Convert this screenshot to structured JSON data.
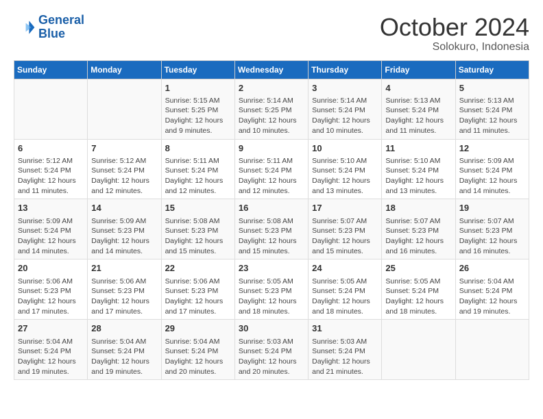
{
  "header": {
    "logo_line1": "General",
    "logo_line2": "Blue",
    "month": "October 2024",
    "location": "Solokuro, Indonesia"
  },
  "weekdays": [
    "Sunday",
    "Monday",
    "Tuesday",
    "Wednesday",
    "Thursday",
    "Friday",
    "Saturday"
  ],
  "weeks": [
    [
      {
        "day": "",
        "info": ""
      },
      {
        "day": "",
        "info": ""
      },
      {
        "day": "1",
        "info": "Sunrise: 5:15 AM\nSunset: 5:25 PM\nDaylight: 12 hours and 9 minutes."
      },
      {
        "day": "2",
        "info": "Sunrise: 5:14 AM\nSunset: 5:25 PM\nDaylight: 12 hours and 10 minutes."
      },
      {
        "day": "3",
        "info": "Sunrise: 5:14 AM\nSunset: 5:24 PM\nDaylight: 12 hours and 10 minutes."
      },
      {
        "day": "4",
        "info": "Sunrise: 5:13 AM\nSunset: 5:24 PM\nDaylight: 12 hours and 11 minutes."
      },
      {
        "day": "5",
        "info": "Sunrise: 5:13 AM\nSunset: 5:24 PM\nDaylight: 12 hours and 11 minutes."
      }
    ],
    [
      {
        "day": "6",
        "info": "Sunrise: 5:12 AM\nSunset: 5:24 PM\nDaylight: 12 hours and 11 minutes."
      },
      {
        "day": "7",
        "info": "Sunrise: 5:12 AM\nSunset: 5:24 PM\nDaylight: 12 hours and 12 minutes."
      },
      {
        "day": "8",
        "info": "Sunrise: 5:11 AM\nSunset: 5:24 PM\nDaylight: 12 hours and 12 minutes."
      },
      {
        "day": "9",
        "info": "Sunrise: 5:11 AM\nSunset: 5:24 PM\nDaylight: 12 hours and 12 minutes."
      },
      {
        "day": "10",
        "info": "Sunrise: 5:10 AM\nSunset: 5:24 PM\nDaylight: 12 hours and 13 minutes."
      },
      {
        "day": "11",
        "info": "Sunrise: 5:10 AM\nSunset: 5:24 PM\nDaylight: 12 hours and 13 minutes."
      },
      {
        "day": "12",
        "info": "Sunrise: 5:09 AM\nSunset: 5:24 PM\nDaylight: 12 hours and 14 minutes."
      }
    ],
    [
      {
        "day": "13",
        "info": "Sunrise: 5:09 AM\nSunset: 5:24 PM\nDaylight: 12 hours and 14 minutes."
      },
      {
        "day": "14",
        "info": "Sunrise: 5:09 AM\nSunset: 5:23 PM\nDaylight: 12 hours and 14 minutes."
      },
      {
        "day": "15",
        "info": "Sunrise: 5:08 AM\nSunset: 5:23 PM\nDaylight: 12 hours and 15 minutes."
      },
      {
        "day": "16",
        "info": "Sunrise: 5:08 AM\nSunset: 5:23 PM\nDaylight: 12 hours and 15 minutes."
      },
      {
        "day": "17",
        "info": "Sunrise: 5:07 AM\nSunset: 5:23 PM\nDaylight: 12 hours and 15 minutes."
      },
      {
        "day": "18",
        "info": "Sunrise: 5:07 AM\nSunset: 5:23 PM\nDaylight: 12 hours and 16 minutes."
      },
      {
        "day": "19",
        "info": "Sunrise: 5:07 AM\nSunset: 5:23 PM\nDaylight: 12 hours and 16 minutes."
      }
    ],
    [
      {
        "day": "20",
        "info": "Sunrise: 5:06 AM\nSunset: 5:23 PM\nDaylight: 12 hours and 17 minutes."
      },
      {
        "day": "21",
        "info": "Sunrise: 5:06 AM\nSunset: 5:23 PM\nDaylight: 12 hours and 17 minutes."
      },
      {
        "day": "22",
        "info": "Sunrise: 5:06 AM\nSunset: 5:23 PM\nDaylight: 12 hours and 17 minutes."
      },
      {
        "day": "23",
        "info": "Sunrise: 5:05 AM\nSunset: 5:23 PM\nDaylight: 12 hours and 18 minutes."
      },
      {
        "day": "24",
        "info": "Sunrise: 5:05 AM\nSunset: 5:24 PM\nDaylight: 12 hours and 18 minutes."
      },
      {
        "day": "25",
        "info": "Sunrise: 5:05 AM\nSunset: 5:24 PM\nDaylight: 12 hours and 18 minutes."
      },
      {
        "day": "26",
        "info": "Sunrise: 5:04 AM\nSunset: 5:24 PM\nDaylight: 12 hours and 19 minutes."
      }
    ],
    [
      {
        "day": "27",
        "info": "Sunrise: 5:04 AM\nSunset: 5:24 PM\nDaylight: 12 hours and 19 minutes."
      },
      {
        "day": "28",
        "info": "Sunrise: 5:04 AM\nSunset: 5:24 PM\nDaylight: 12 hours and 19 minutes."
      },
      {
        "day": "29",
        "info": "Sunrise: 5:04 AM\nSunset: 5:24 PM\nDaylight: 12 hours and 20 minutes."
      },
      {
        "day": "30",
        "info": "Sunrise: 5:03 AM\nSunset: 5:24 PM\nDaylight: 12 hours and 20 minutes."
      },
      {
        "day": "31",
        "info": "Sunrise: 5:03 AM\nSunset: 5:24 PM\nDaylight: 12 hours and 21 minutes."
      },
      {
        "day": "",
        "info": ""
      },
      {
        "day": "",
        "info": ""
      }
    ]
  ]
}
